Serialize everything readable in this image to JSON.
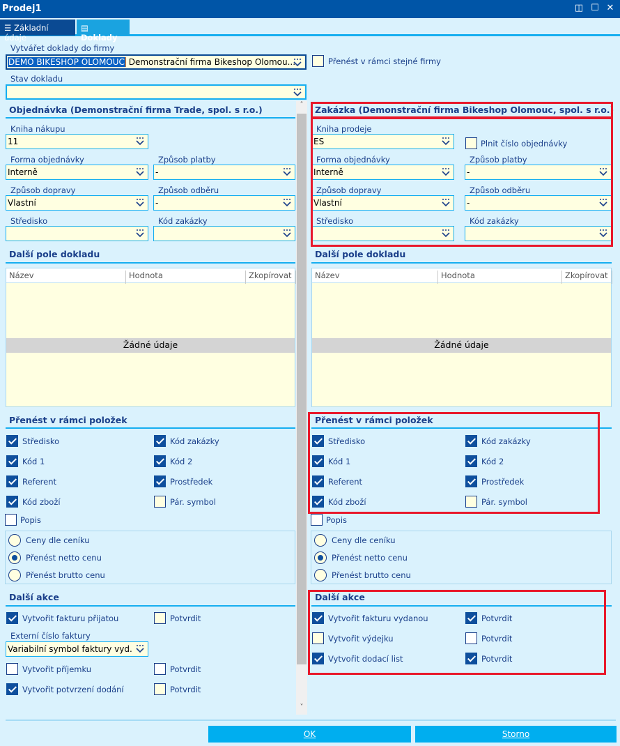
{
  "window": {
    "title": "Prodej1"
  },
  "tabs": [
    {
      "label": "Základní údaje",
      "icon": "list-icon"
    },
    {
      "label": "Doklady",
      "icon": "document-icon",
      "active": true
    }
  ],
  "top": {
    "firm_label": "Vytvářet doklady do firmy",
    "firm_code": "DEMO BIKESHOP OLOMOUC",
    "firm_name": "Demonstrační firma Bikeshop Olomou...",
    "same_firm_label": "Přenést v rámci stejné firmy",
    "same_firm_checked": false,
    "status_label": "Stav dokladu",
    "status_value": ""
  },
  "left": {
    "heading": "Objednávka (Demonstrační firma Trade, spol. s r.o.)",
    "book_label": "Kniha nákupu",
    "book_value": "11",
    "form_label": "Forma objednávky",
    "form_value": "Interně",
    "payment_label": "Způsob platby",
    "payment_value": "-",
    "transport_label": "Způsob dopravy",
    "transport_value": "Vlastní",
    "pickup_label": "Způsob odběru",
    "pickup_value": "-",
    "center_label": "Středisko",
    "center_value": "",
    "order_code_label": "Kód zakázky",
    "order_code_value": "",
    "fields_heading": "Další pole dokladu",
    "grid_cols": [
      "Název",
      "Hodnota",
      "Zkopírovat"
    ],
    "grid_empty": "Žádné údaje",
    "items_heading": "Přenést v rámci položek",
    "items": [
      {
        "label": "Středisko",
        "checked": true
      },
      {
        "label": "Kód zakázky",
        "checked": true
      },
      {
        "label": "Kód 1",
        "checked": true
      },
      {
        "label": "Kód 2",
        "checked": true
      },
      {
        "label": "Referent",
        "checked": true
      },
      {
        "label": "Prostředek",
        "checked": true
      },
      {
        "label": "Kód zboží",
        "checked": true
      },
      {
        "label": "Pár. symbol",
        "checked": false
      }
    ],
    "popis": {
      "label": "Popis",
      "checked": false
    },
    "prices": [
      "Ceny dle ceníku",
      "Přenést netto cenu",
      "Přenést brutto cenu"
    ],
    "price_selected": 1,
    "actions_heading": "Další akce",
    "actions": [
      {
        "label": "Vytvořit fakturu přijatou",
        "checked": true,
        "confirm": "Potvrdit",
        "confirm_checked": false
      },
      {
        "label": "Vytvořit příjemku",
        "checked": false,
        "confirm": "Potvrdit",
        "confirm_checked": false
      },
      {
        "label": "Vytvořit potvrzení dodání",
        "checked": true,
        "confirm": "Potvrdit",
        "confirm_checked": false
      }
    ],
    "ext_label": "Externí číslo faktury",
    "ext_value": "Variabilní symbol faktury vyd."
  },
  "right": {
    "heading": "Zakázka (Demonstrační firma Bikeshop Olomouc, spol. s r.o.)",
    "book_label": "Kniha prodeje",
    "book_value": "ES",
    "fill_order_label": "Plnit číslo objednávky",
    "fill_order_checked": false,
    "form_label": "Forma objednávky",
    "form_value": "Interně",
    "payment_label": "Způsob platby",
    "payment_value": "-",
    "transport_label": "Způsob dopravy",
    "transport_value": "Vlastní",
    "pickup_label": "Způsob odběru",
    "pickup_value": "-",
    "center_label": "Středisko",
    "center_value": "",
    "order_code_label": "Kód zakázky",
    "order_code_value": "",
    "fields_heading": "Další pole dokladu",
    "grid_cols": [
      "Název",
      "Hodnota",
      "Zkopírovat"
    ],
    "grid_empty": "Žádné údaje",
    "items_heading": "Přenést v rámci položek",
    "items": [
      {
        "label": "Středisko",
        "checked": true
      },
      {
        "label": "Kód zakázky",
        "checked": true
      },
      {
        "label": "Kód 1",
        "checked": true
      },
      {
        "label": "Kód 2",
        "checked": true
      },
      {
        "label": "Referent",
        "checked": true
      },
      {
        "label": "Prostředek",
        "checked": true
      },
      {
        "label": "Kód zboží",
        "checked": true
      },
      {
        "label": "Pár. symbol",
        "checked": false
      }
    ],
    "popis": {
      "label": "Popis",
      "checked": false
    },
    "prices": [
      "Ceny dle ceníku",
      "Přenést netto cenu",
      "Přenést brutto cenu"
    ],
    "price_selected": 1,
    "actions_heading": "Další akce",
    "actions": [
      {
        "label": "Vytvořit fakturu vydanou",
        "checked": true,
        "confirm": "Potvrdit",
        "confirm_checked": true
      },
      {
        "label": "Vytvořit výdejku",
        "checked": false,
        "confirm": "Potvrdit",
        "confirm_checked": false
      },
      {
        "label": "Vytvořit dodací list",
        "checked": true,
        "confirm": "Potvrdit",
        "confirm_checked": true
      }
    ]
  },
  "buttons": {
    "ok": "OK",
    "cancel": "Storno"
  },
  "colors": {
    "titlebar": "#0055a7",
    "accent": "#16aef0",
    "highlight": "#e8192c",
    "checked": "#0e4f9d"
  }
}
